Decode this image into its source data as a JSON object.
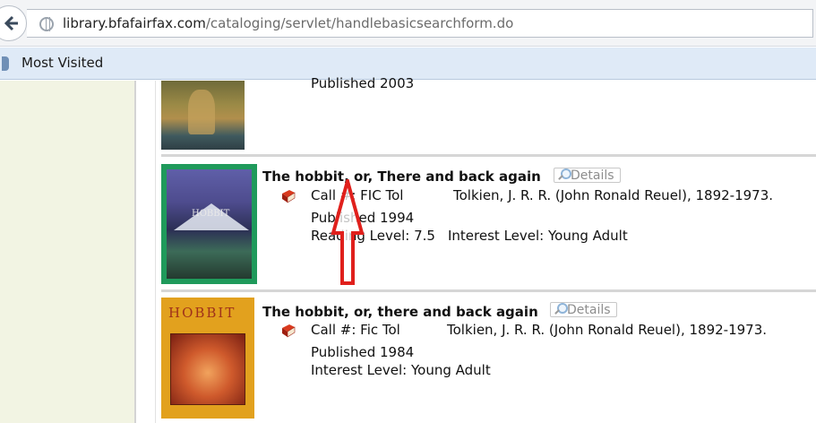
{
  "browser": {
    "url_host": "library.bfafairfax.com",
    "url_path": "/cataloging/servlet/handlebasicsearchform.do",
    "bookmarks": [
      "Most Visited"
    ]
  },
  "results": [
    {
      "published": "Published 2003"
    },
    {
      "title": "The hobbit, or, There and back again",
      "details_label": "Details",
      "call_label": "Call #: FIC Tol",
      "author": "Tolkien, J. R. R. (John Ronald Reuel), 1892-1973.",
      "published": "Published 1994",
      "reading_level": "Reading Level: 7.5",
      "interest_level": "Interest Level: Young Adult",
      "cover_text": "HOBBIT"
    },
    {
      "title": "The hobbit, or, there and back again",
      "details_label": "Details",
      "call_label": "Call #: Fic Tol",
      "author": "Tolkien, J. R. R. (John Ronald Reuel), 1892-1973.",
      "published": "Published 1984",
      "interest_level": "Interest Level: Young Adult",
      "cover_text": "HOBBIT"
    }
  ],
  "colors": {
    "annotation_arrow": "#e0201c",
    "sidebar_bg": "#f2f4e3",
    "bookmarks_bg": "#dfeaf7"
  }
}
